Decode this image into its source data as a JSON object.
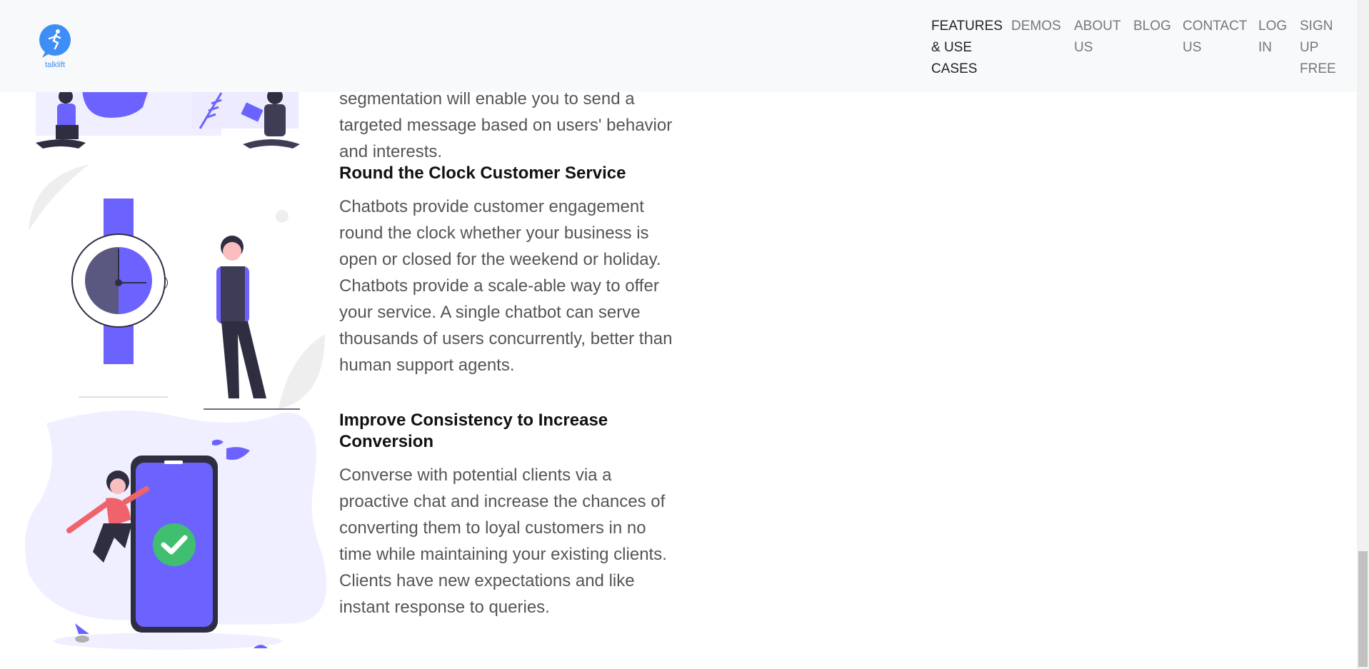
{
  "brand": {
    "name": "talklift"
  },
  "nav": [
    {
      "label": "FEATURES\n& USE\nCASES",
      "active": true
    },
    {
      "label": "DEMOS"
    },
    {
      "label": "ABOUT\nUS"
    },
    {
      "label": "BLOG"
    },
    {
      "label": "CONTACT\nUS"
    },
    {
      "label": "LOG\nIN"
    },
    {
      "label": "SIGN\nUP\nFREE"
    }
  ],
  "sections": [
    {
      "text_partial": "segmentation will enable you to send a targeted message based on users' behavior and interests."
    },
    {
      "title": "Round the Clock Customer Service",
      "text": "Chatbots provide customer engagement round the clock whether your business is open or closed for the weekend or holiday. Chatbots provide a scale-able way to offer your service. A single chatbot can serve thousands of users concurrently, better than human support agents."
    },
    {
      "title": "Improve Consistency to Increase Conversion",
      "text": "Converse with potential clients via a proactive chat and increase the chances of converting them to loyal customers in no time while maintaining your existing clients. Clients have new expectations and like instant response to queries."
    }
  ],
  "colors": {
    "accent": "#6c63ff",
    "brand": "#3d8ef7",
    "check": "#3fbf6f",
    "person": "#f0636b"
  }
}
